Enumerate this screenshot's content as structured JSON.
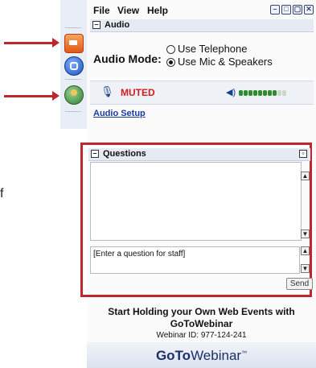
{
  "menu": {
    "file": "File",
    "view": "View",
    "help": "Help"
  },
  "audio": {
    "section_title": "Audio",
    "mode_label": "Audio Mode:",
    "options": [
      "Use Telephone",
      "Use Mic & Speakers"
    ],
    "selected_option": "Use Mic & Speakers",
    "mic_status": "MUTED",
    "setup_link": "Audio Setup"
  },
  "questions": {
    "section_title": "Questions",
    "input_placeholder": "[Enter a question for staff]",
    "send_label": "Send"
  },
  "footer": {
    "promo_line1": "Start Holding your Own Web Events with",
    "promo_line2": "GoToWebinar",
    "webinar_id": "Webinar ID: 977-124-241",
    "logo_bold": "GoTo",
    "logo_light": "Webinar",
    "logo_tm": "™"
  },
  "partial_text": "f",
  "icons": [
    "arrow-button-icon",
    "screen-button-icon",
    "raise-hand-icon",
    "microphone-icon",
    "speaker-icon"
  ],
  "colors": {
    "accent": "#c0262e",
    "muted": "#d01d1d",
    "link": "#1a3aa0",
    "level_on": "#2e8b2e",
    "level_off": "#c9d7c9"
  },
  "audio_level": {
    "segments_on": 8,
    "segments_total": 10
  }
}
